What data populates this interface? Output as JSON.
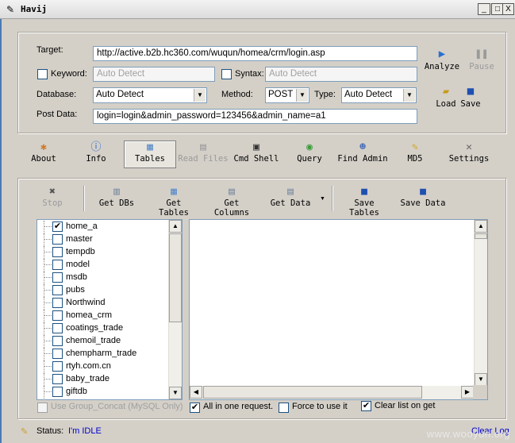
{
  "window": {
    "title": "Havij",
    "buttons": [
      "_",
      "□",
      "X"
    ]
  },
  "form": {
    "target_label": "Target:",
    "target_value": "http://active.b2b.hc360.com/wuqun/homea/crm/login.asp",
    "keyword_label": "Keyword:",
    "keyword_placeholder": "Auto Detect",
    "syntax_label": "Syntax:",
    "syntax_placeholder": "Auto Detect",
    "database_label": "Database:",
    "database_value": "Auto Detect",
    "method_label": "Method:",
    "method_value": "POST",
    "type_label": "Type:",
    "type_value": "Auto Detect",
    "postdata_label": "Post Data:",
    "postdata_value": "login=login&admin_password=123456&admin_name=a1"
  },
  "side_buttons": {
    "analyze": "Analyze",
    "pause": "Pause",
    "load": "Load",
    "save": "Save"
  },
  "toolbar": {
    "about": "About",
    "info": "Info",
    "tables": "Tables",
    "read_files": "Read Files",
    "cmd_shell": "Cmd Shell",
    "query": "Query",
    "find_admin": "Find Admin",
    "md5": "MD5",
    "settings": "Settings"
  },
  "subtoolbar": {
    "stop": "Stop",
    "get_dbs": "Get DBs",
    "get_tables": "Get Tables",
    "get_columns": "Get Columns",
    "get_data": "Get Data",
    "save_tables": "Save Tables",
    "save_data": "Save Data"
  },
  "tree": {
    "items": [
      {
        "label": "home_a",
        "checked": true
      },
      {
        "label": "master",
        "checked": false
      },
      {
        "label": "tempdb",
        "checked": false
      },
      {
        "label": "model",
        "checked": false
      },
      {
        "label": "msdb",
        "checked": false
      },
      {
        "label": "pubs",
        "checked": false
      },
      {
        "label": "Northwind",
        "checked": false
      },
      {
        "label": "homea_crm",
        "checked": false
      },
      {
        "label": "coatings_trade",
        "checked": false
      },
      {
        "label": "chemoil_trade",
        "checked": false
      },
      {
        "label": "chempharm_trade",
        "checked": false
      },
      {
        "label": "rtyh.com.cn",
        "checked": false
      },
      {
        "label": "baby_trade",
        "checked": false
      },
      {
        "label": "giftdb",
        "checked": false
      }
    ]
  },
  "options": {
    "group_concat": "Use Group_Concat (MySQL Only)",
    "all_in_one": "All in one request.",
    "force_use": "Force to use it",
    "clear_list": "Clear list on get"
  },
  "status": {
    "label": "Status:",
    "value": "I'm IDLE",
    "clear_log": "Clear Log"
  },
  "watermark": "www.wooyun.org",
  "colors": {
    "background": "#d4d0c8",
    "status_link": "#0000cc",
    "input_border": "#7f9db9"
  }
}
